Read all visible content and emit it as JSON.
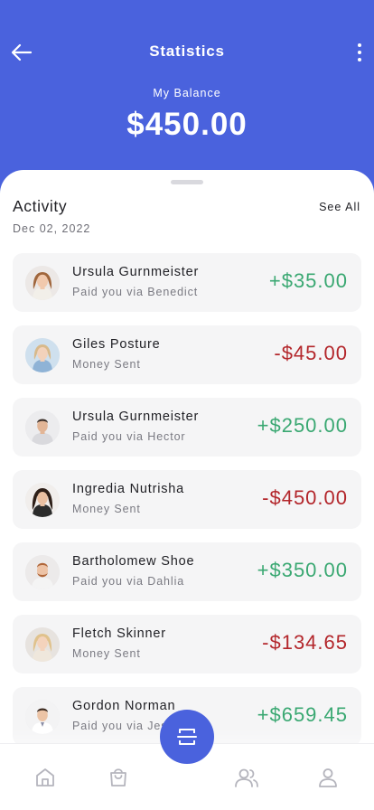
{
  "header": {
    "title": "Statistics",
    "balance_label": "My Balance",
    "balance_value": "$450.00",
    "back_icon": "arrow-left-icon",
    "more_icon": "more-vertical-icon"
  },
  "activity": {
    "title": "Activity",
    "see_all": "See All",
    "date": "Dec 02, 2022",
    "items": [
      {
        "name": "Ursula Gurnmeister",
        "subtitle": "Paid you via Benedict",
        "amount": "+$35.00",
        "type": "positive"
      },
      {
        "name": "Giles Posture",
        "subtitle": "Money Sent",
        "amount": "-$45.00",
        "type": "negative"
      },
      {
        "name": "Ursula Gurnmeister",
        "subtitle": "Paid you via Hector",
        "amount": "+$250.00",
        "type": "positive"
      },
      {
        "name": "Ingredia Nutrisha",
        "subtitle": "Money Sent",
        "amount": "-$450.00",
        "type": "negative"
      },
      {
        "name": "Bartholomew Shoe",
        "subtitle": "Paid you via Dahlia",
        "amount": "+$350.00",
        "type": "positive"
      },
      {
        "name": "Fletch Skinner",
        "subtitle": "Money Sent",
        "amount": "-$134.65",
        "type": "negative"
      },
      {
        "name": "Gordon Norman",
        "subtitle": "Paid you via Jesse",
        "amount": "+$659.45",
        "type": "positive"
      }
    ]
  },
  "nav": {
    "items": [
      "home-icon",
      "shopping-bag-icon",
      "scan-icon",
      "users-icon",
      "user-icon"
    ]
  },
  "colors": {
    "primary": "#4a62dd",
    "positive": "#3aa872",
    "negative": "#b3262b"
  }
}
